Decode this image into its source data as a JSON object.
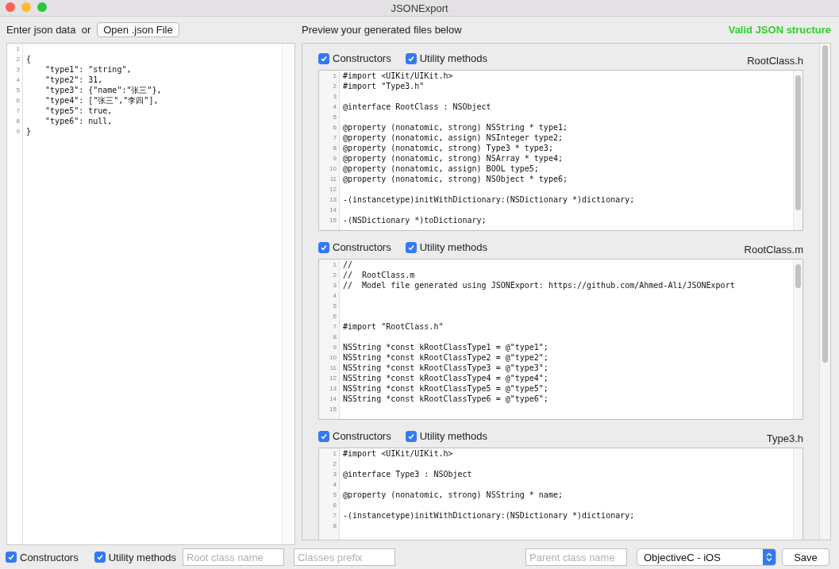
{
  "window": {
    "title": "JSONExport"
  },
  "input": {
    "label": "Enter json data  or",
    "open_button": "Open .json File",
    "lines": [
      {
        "number": "1"
      },
      {
        "number": "2",
        "text": "{"
      },
      {
        "number": "3",
        "text": "    \"type1\": \"string\","
      },
      {
        "number": "4",
        "text": "    \"type2\": 31,"
      },
      {
        "number": "5",
        "text": "    \"type3\": {\"name\":\"张三\"},"
      },
      {
        "number": "6",
        "text": "    \"type4\": [\"张三\",\"李四\"],"
      },
      {
        "number": "7",
        "text": "    \"type5\": true,"
      },
      {
        "number": "8",
        "text": "    \"type6\": null,"
      },
      {
        "number": "9",
        "text": "}"
      }
    ]
  },
  "preview": {
    "heading": "Preview your generated files below",
    "status": "Valid JSON structure",
    "files": [
      {
        "name": "RootClass.h",
        "options": [
          {
            "label": "Constructors",
            "checked": true
          },
          {
            "label": "Utility methods",
            "checked": true
          }
        ],
        "lines": [
          {
            "number": "1",
            "text": "#import <UIKit/UIKit.h>"
          },
          {
            "number": "2",
            "text": "#import \"Type3.h\""
          },
          {
            "number": "3"
          },
          {
            "number": "4",
            "text": "@interface RootClass : NSObject"
          },
          {
            "number": "5"
          },
          {
            "number": "6",
            "text": "@property (nonatomic, strong) NSString * type1;"
          },
          {
            "number": "7",
            "text": "@property (nonatomic, assign) NSInteger type2;"
          },
          {
            "number": "8",
            "text": "@property (nonatomic, strong) Type3 * type3;"
          },
          {
            "number": "9",
            "text": "@property (nonatomic, strong) NSArray * type4;"
          },
          {
            "number": "10",
            "text": "@property (nonatomic, assign) BOOL type5;"
          },
          {
            "number": "11",
            "text": "@property (nonatomic, strong) NSObject * type6;"
          },
          {
            "number": "12"
          },
          {
            "number": "13",
            "text": "-(instancetype)initWithDictionary:(NSDictionary *)dictionary;"
          },
          {
            "number": "14"
          },
          {
            "number": "15",
            "text": "-(NSDictionary *)toDictionary;"
          }
        ]
      },
      {
        "name": "RootClass.m",
        "options": [
          {
            "label": "Constructors",
            "checked": true
          },
          {
            "label": "Utility methods",
            "checked": true
          }
        ],
        "lines": [
          {
            "number": "1",
            "text": "//"
          },
          {
            "number": "2",
            "text": "//  RootClass.m"
          },
          {
            "number": "3",
            "text": "//  Model file generated using JSONExport: https://github.com/Ahmed-Ali/JSONExport"
          },
          {
            "number": "4"
          },
          {
            "number": "5"
          },
          {
            "number": "6"
          },
          {
            "number": "7",
            "text": "#import \"RootClass.h\""
          },
          {
            "number": "8"
          },
          {
            "number": "9",
            "text": "NSString *const kRootClassType1 = @\"type1\";"
          },
          {
            "number": "10",
            "text": "NSString *const kRootClassType2 = @\"type2\";"
          },
          {
            "number": "11",
            "text": "NSString *const kRootClassType3 = @\"type3\";"
          },
          {
            "number": "12",
            "text": "NSString *const kRootClassType4 = @\"type4\";"
          },
          {
            "number": "13",
            "text": "NSString *const kRootClassType5 = @\"type5\";"
          },
          {
            "number": "14",
            "text": "NSString *const kRootClassType6 = @\"type6\";"
          },
          {
            "number": "15"
          }
        ]
      },
      {
        "name": "Type3.h",
        "options": [
          {
            "label": "Constructors",
            "checked": true
          },
          {
            "label": "Utility methods",
            "checked": true
          }
        ],
        "lines": [
          {
            "number": "1",
            "text": "#import <UIKit/UIKit.h>"
          },
          {
            "number": "2"
          },
          {
            "number": "3",
            "text": "@interface Type3 : NSObject"
          },
          {
            "number": "4"
          },
          {
            "number": "5",
            "text": "@property (nonatomic, strong) NSString * name;"
          },
          {
            "number": "6"
          },
          {
            "number": "7",
            "text": "-(instancetype)initWithDictionary:(NSDictionary *)dictionary;"
          },
          {
            "number": "8"
          }
        ]
      }
    ]
  },
  "footer": {
    "options": [
      {
        "label": "Constructors",
        "checked": true
      },
      {
        "label": "Utility methods",
        "checked": true
      }
    ],
    "root_class": {
      "placeholder": "Root class name"
    },
    "prefix": {
      "placeholder": "Classes prefix"
    },
    "parent_class": {
      "placeholder": "Parent class name"
    },
    "language": "ObjectiveC - iOS",
    "save_button": "Save"
  }
}
